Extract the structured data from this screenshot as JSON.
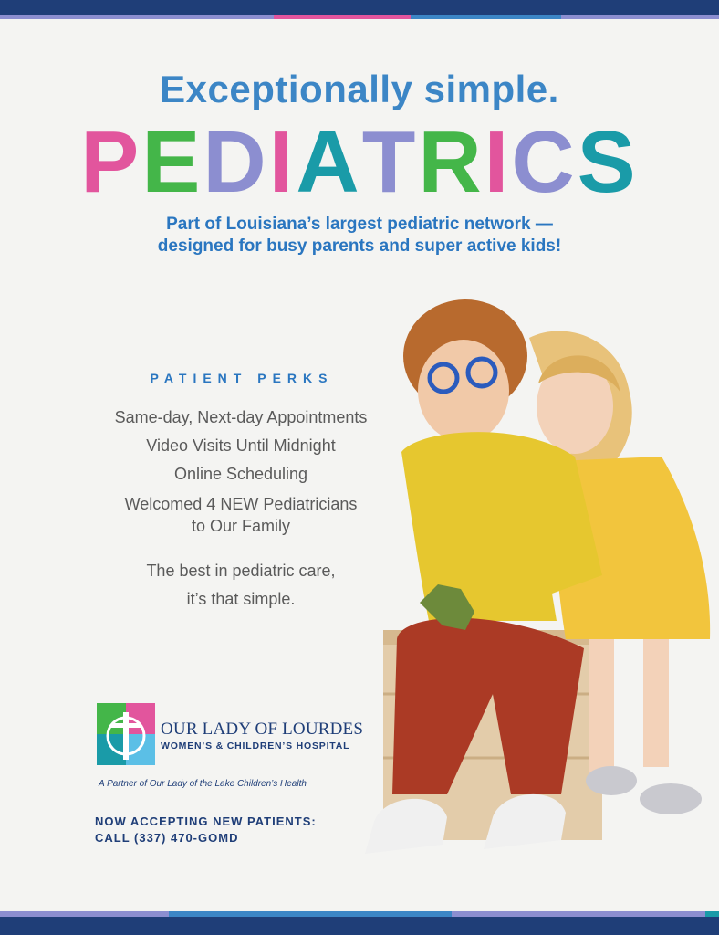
{
  "header": {
    "tagline": "Exceptionally simple.",
    "title_letters": [
      "P",
      "E",
      "D",
      "I",
      "A",
      "T",
      "R",
      "I",
      "C",
      "S"
    ],
    "subhead_line1": "Part of Louisiana’s largest pediatric network —",
    "subhead_line2": "designed for busy parents and super active kids!"
  },
  "perks": {
    "title": "PATIENT PERKS",
    "items": [
      "Same-day, Next-day Appointments",
      "Video Visits Until Midnight",
      "Online Scheduling"
    ],
    "new_line1": "Welcomed 4 NEW Pediatricians",
    "new_line2": "to Our Family",
    "closing_line1": "The best in pediatric care,",
    "closing_line2": "it’s that simple."
  },
  "logo": {
    "name": "OUR LADY OF LOURDES",
    "subtitle": "WOMEN’S & CHILDREN’S HOSPITAL",
    "partner": "A Partner of Our Lady of the Lake Children’s Health"
  },
  "cta": {
    "line1": "NOW ACCEPTING NEW PATIENTS:",
    "line2": "CALL (337) 470-GOMD"
  },
  "colors": {
    "navy": "#1f3e78",
    "blue": "#3c86c6",
    "pink": "#e2559d",
    "green": "#44b649",
    "purple": "#8c8ed0",
    "teal": "#1a9ba8",
    "lightblue": "#5bbfe6"
  }
}
